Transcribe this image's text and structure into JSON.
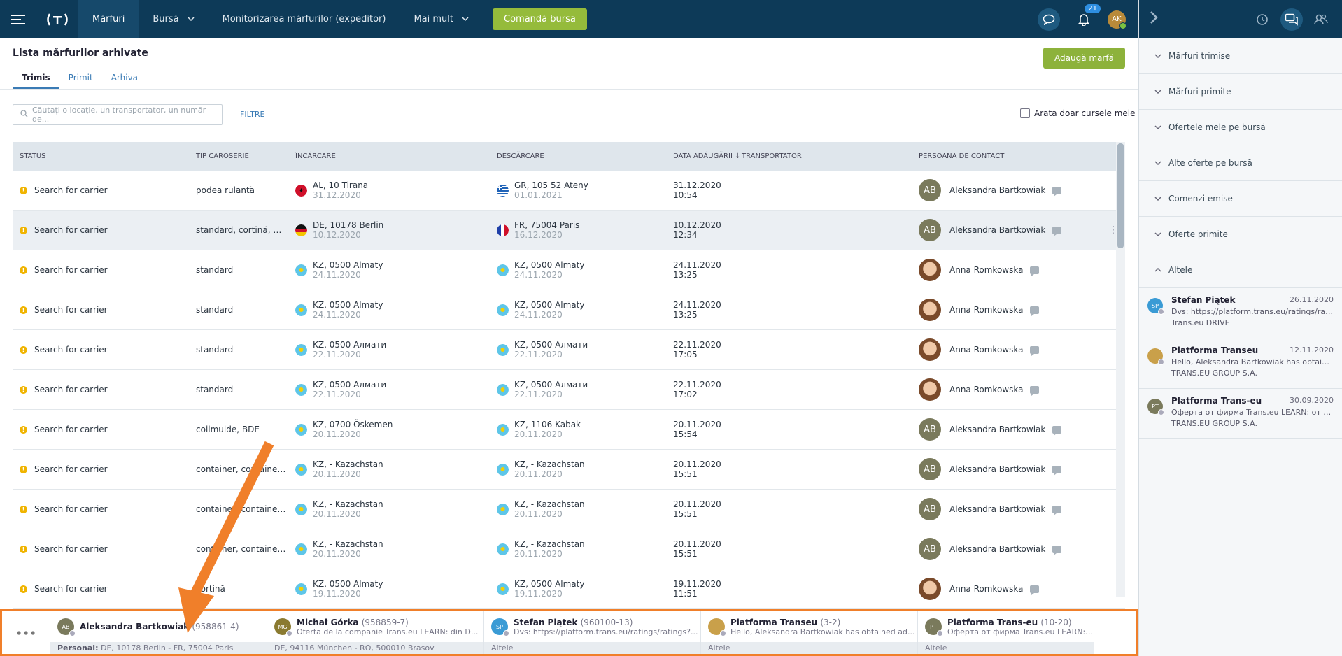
{
  "topbar": {
    "nav": [
      {
        "label": "Mărfuri",
        "active": true,
        "chevron": false
      },
      {
        "label": "Bursă",
        "active": false,
        "chevron": true
      },
      {
        "label": "Monitorizarea mărfurilor (expeditor)",
        "active": false,
        "chevron": false
      },
      {
        "label": "Mai mult",
        "active": false,
        "chevron": true
      }
    ],
    "cta_label": "Comandă bursa",
    "notification_count": "21",
    "user_initials": "AK"
  },
  "page": {
    "title": "Lista mărfurilor arhivate",
    "add_button": "Adaugă marfă",
    "tabs": [
      {
        "label": "Trimis",
        "active": true
      },
      {
        "label": "Primit",
        "active": false
      },
      {
        "label": "Arhiva",
        "active": false
      }
    ],
    "search_placeholder": "Căutați o locație, un transportator, un număr de...",
    "filter_label": "FILTRE",
    "only_mine_label": "Arata doar cursele mele"
  },
  "table": {
    "headers": {
      "status": "STATUS",
      "tip": "TIP CAROSERIE",
      "incarcare": "ÎNCĂRCARE",
      "descarcare": "DESCĂRCARE",
      "data": "DATA ADĂUGĂRII ↓",
      "transportator": "TRANSPORTATOR",
      "contact": "PERSOANA DE CONTACT"
    },
    "rows": [
      {
        "status": "Search for carrier",
        "tip": "podea rulantă",
        "inc_flag": "al",
        "inc": "AL, 10 Tirana",
        "inc_date": "31.12.2020",
        "des_flag": "gr",
        "des": "GR, 105 52 Ateny",
        "des_date": "01.01.2021",
        "date": "31.12.2020",
        "time": "10:54",
        "contact": "Aleksandra Bartkowiak",
        "avatar": "AB",
        "photo": false
      },
      {
        "status": "Search for carrier",
        "tip": "standard, cortină, me...",
        "inc_flag": "de",
        "inc": "DE, 10178 Berlin",
        "inc_date": "10.12.2020",
        "des_flag": "fr",
        "des": "FR, 75004 Paris",
        "des_date": "16.12.2020",
        "date": "10.12.2020",
        "time": "12:34",
        "contact": "Aleksandra Bartkowiak",
        "avatar": "AB",
        "photo": false,
        "hover": true
      },
      {
        "status": "Search for carrier",
        "tip": "standard",
        "inc_flag": "kz",
        "inc": "KZ, 0500 Almaty",
        "inc_date": "24.11.2020",
        "des_flag": "kz",
        "des": "KZ, 0500 Almaty",
        "des_date": "24.11.2020",
        "date": "24.11.2020",
        "time": "13:25",
        "contact": "Anna Romkowska",
        "avatar": "",
        "photo": true
      },
      {
        "status": "Search for carrier",
        "tip": "standard",
        "inc_flag": "kz",
        "inc": "KZ, 0500 Almaty",
        "inc_date": "24.11.2020",
        "des_flag": "kz",
        "des": "KZ, 0500 Almaty",
        "des_date": "24.11.2020",
        "date": "24.11.2020",
        "time": "13:25",
        "contact": "Anna Romkowska",
        "avatar": "",
        "photo": true
      },
      {
        "status": "Search for carrier",
        "tip": "standard",
        "inc_flag": "kz",
        "inc": "KZ, 0500 Алмати",
        "inc_date": "22.11.2020",
        "des_flag": "kz",
        "des": "KZ, 0500 Алмати",
        "des_date": "22.11.2020",
        "date": "22.11.2020",
        "time": "17:05",
        "contact": "Anna Romkowska",
        "avatar": "",
        "photo": true
      },
      {
        "status": "Search for carrier",
        "tip": "standard",
        "inc_flag": "kz",
        "inc": "KZ, 0500 Алмати",
        "inc_date": "22.11.2020",
        "des_flag": "kz",
        "des": "KZ, 0500 Алмати",
        "des_date": "22.11.2020",
        "date": "22.11.2020",
        "time": "17:02",
        "contact": "Anna Romkowska",
        "avatar": "",
        "photo": true
      },
      {
        "status": "Search for carrier",
        "tip": "coilmulde, BDE",
        "inc_flag": "kz",
        "inc": "KZ, 0700 Öskemen",
        "inc_date": "20.11.2020",
        "des_flag": "kz",
        "des": "KZ, 1106 Kabak",
        "des_date": "20.11.2020",
        "date": "20.11.2020",
        "time": "15:54",
        "contact": "Aleksandra Bartkowiak",
        "avatar": "AB",
        "photo": false
      },
      {
        "status": "Search for carrier",
        "tip": "container, container /...",
        "inc_flag": "kz",
        "inc": "KZ, - Kazachstan",
        "inc_date": "20.11.2020",
        "des_flag": "kz",
        "des": "KZ, - Kazachstan",
        "des_date": "20.11.2020",
        "date": "20.11.2020",
        "time": "15:51",
        "contact": "Aleksandra Bartkowiak",
        "avatar": "AB",
        "photo": false
      },
      {
        "status": "Search for carrier",
        "tip": "container, container /...",
        "inc_flag": "kz",
        "inc": "KZ, - Kazachstan",
        "inc_date": "20.11.2020",
        "des_flag": "kz",
        "des": "KZ, - Kazachstan",
        "des_date": "20.11.2020",
        "date": "20.11.2020",
        "time": "15:51",
        "contact": "Aleksandra Bartkowiak",
        "avatar": "AB",
        "photo": false
      },
      {
        "status": "Search for carrier",
        "tip": "container, container /...",
        "inc_flag": "kz",
        "inc": "KZ, - Kazachstan",
        "inc_date": "20.11.2020",
        "des_flag": "kz",
        "des": "KZ, - Kazachstan",
        "des_date": "20.11.2020",
        "date": "20.11.2020",
        "time": "15:51",
        "contact": "Aleksandra Bartkowiak",
        "avatar": "AB",
        "photo": false
      },
      {
        "status": "Search for carrier",
        "tip": "cortină",
        "inc_flag": "kz",
        "inc": "KZ, 0500 Almaty",
        "inc_date": "19.11.2020",
        "des_flag": "kz",
        "des": "KZ, 0500 Almaty",
        "des_date": "19.11.2020",
        "date": "19.11.2020",
        "time": "11:51",
        "contact": "Anna Romkowska",
        "avatar": "",
        "photo": true
      }
    ]
  },
  "rpanel": {
    "sections": [
      {
        "label": "Mărfuri trimise",
        "open": false
      },
      {
        "label": "Mărfuri primite",
        "open": false
      },
      {
        "label": "Ofertele mele pe bursă",
        "open": false
      },
      {
        "label": "Alte oferte pe bursă",
        "open": false
      },
      {
        "label": "Comenzi emise",
        "open": false
      },
      {
        "label": "Oferte primite",
        "open": false
      },
      {
        "label": "Altele",
        "open": true
      }
    ],
    "messages": [
      {
        "initials": "SP",
        "color": "#3a9bd5",
        "name": "Stefan Piątek",
        "date": "26.11.2020",
        "line1": "Dvs: https://platform.trans.eu/ratings/rati...",
        "line2": "Trans.eu DRIVE"
      },
      {
        "initials": "",
        "color": "#c9a04a",
        "name": "Platforma Transeu",
        "date": "12.11.2020",
        "line1": "Hello, Aleksandra Bartkowiak has obtained...",
        "line2": "TRANS.EU GROUP S.A."
      },
      {
        "initials": "PT",
        "color": "#7a7a5c",
        "name": "Platforma Trans-eu",
        "date": "30.09.2020",
        "line1": "Оферта от фирма Trans.eu LEARN: от PL...",
        "line2": "TRANS.EU GROUP S.A."
      }
    ]
  },
  "dock": {
    "chats": [
      {
        "initials": "AB",
        "color": "#7a7a5c",
        "name": "Aleksandra Bartkowiak",
        "id": "(958861-4)",
        "line": "",
        "bottom_bold": "Personal:",
        "bottom": "DE, 10178 Berlin - FR, 75004 Paris"
      },
      {
        "initials": "MG",
        "color": "#8a7a30",
        "name": "Michał Górka",
        "id": "(958859-7)",
        "line": "Oferta de la companie Trans.eu LEARN: din D...",
        "bottom_bold": "",
        "bottom": "DE, 94116 München - RO, 500010 Brasov"
      },
      {
        "initials": "SP",
        "color": "#3a9bd5",
        "name": "Stefan Piątek",
        "id": "(960100-13)",
        "line": "Dvs: https://platform.trans.eu/ratings/ratings?...",
        "bottom_bold": "",
        "bottom": "Altele"
      },
      {
        "initials": "",
        "color": "#c9a04a",
        "name": "Platforma Transeu",
        "id": "(3-2)",
        "line": "Hello, Aleksandra Bartkowiak has obtained ad...",
        "bottom_bold": "",
        "bottom": "Altele"
      },
      {
        "initials": "PT",
        "color": "#7a7a5c",
        "name": "Platforma Trans-eu",
        "id": "(10-20)",
        "line": "Оферта от фирма Trans.eu LEARN: от PL, 61...",
        "bottom_bold": "",
        "bottom": "Altele"
      }
    ]
  },
  "colors": {
    "accent": "#8db23b",
    "nav_bg": "#0d3a58",
    "highlight": "#f07f2a"
  }
}
